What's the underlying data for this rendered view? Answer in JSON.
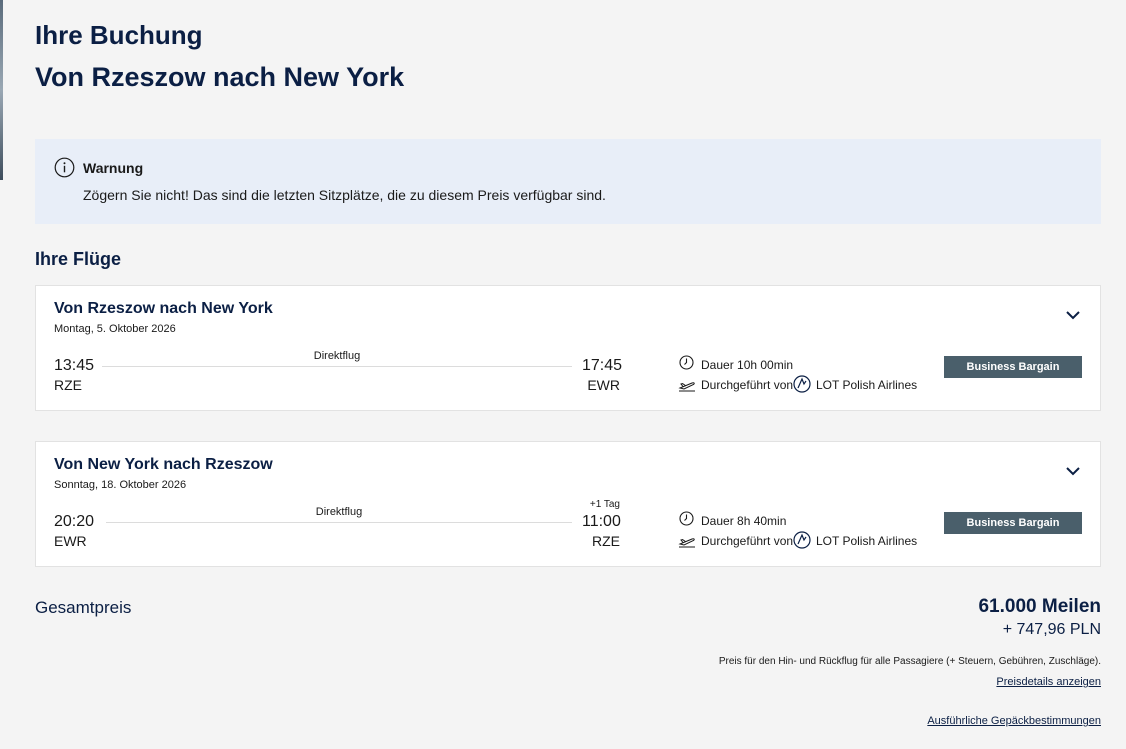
{
  "header": {
    "title": "Ihre Buchung",
    "subtitle": "Von Rzeszow nach New York"
  },
  "warning": {
    "icon": "info-icon",
    "title": "Warnung",
    "text": "Zögern Sie nicht! Das sind die letzten Sitzplätze, die zu diesem Preis verfügbar sind."
  },
  "flights_section": {
    "title": "Ihre Flüge",
    "flights": [
      {
        "route": "Von Rzeszow nach New York",
        "date": "Montag, 5. Oktober 2026",
        "dep_time": "13:45",
        "dep_code": "RZE",
        "arr_time": "17:45",
        "arr_code": "EWR",
        "next_day": "",
        "stop_label": "Direktflug",
        "duration": "Dauer 10h 00min",
        "operated_by": "Durchgeführt von",
        "airline": "LOT Polish Airlines",
        "fare": "Business Bargain"
      },
      {
        "route": "Von New York nach Rzeszow",
        "date": "Sonntag, 18. Oktober 2026",
        "dep_time": "20:20",
        "dep_code": "EWR",
        "arr_time": "11:00",
        "arr_code": "RZE",
        "next_day": "+1 Tag",
        "stop_label": "Direktflug",
        "duration": "Dauer 8h 40min",
        "operated_by": "Durchgeführt von",
        "airline": "LOT Polish Airlines",
        "fare": "Business Bargain"
      }
    ]
  },
  "total": {
    "label": "Gesamtpreis",
    "miles": "61.000 Meilen",
    "money": "+ 747,96 PLN",
    "note": "Preis für den Hin- und Rückflug für alle Passagiere (+ Steuern, Gebühren, Zuschläge).",
    "details_link": "Preisdetails anzeigen",
    "baggage_link": "Ausführliche Gepäckbestimmungen"
  },
  "colors": {
    "navy": "#0b1f44",
    "warning_bg": "#e8eef8",
    "fare_badge": "#4a5f6b",
    "page_bg": "#f4f4f4"
  }
}
